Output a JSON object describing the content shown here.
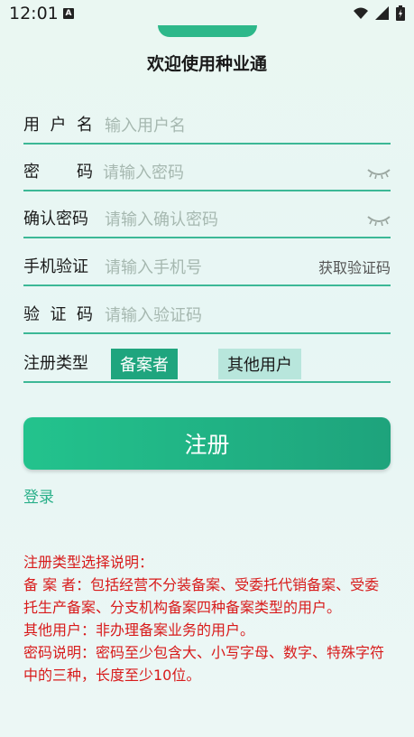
{
  "status_bar": {
    "time": "12:01",
    "notification_icon_letter": "A",
    "icons": [
      "wifi-icon",
      "signal-icon",
      "battery-icon"
    ]
  },
  "title": "欢迎使用种业通",
  "form": {
    "username": {
      "label": "用户名",
      "placeholder": "输入用户名"
    },
    "password": {
      "label": "密码",
      "placeholder": "请输入密码"
    },
    "confirm_password": {
      "label": "确认密码",
      "placeholder": "请输入确认密码"
    },
    "phone": {
      "label": "手机验证",
      "placeholder": "请输入手机号",
      "get_code": "获取验证码"
    },
    "code": {
      "label": "验证码",
      "placeholder": "请输入验证码"
    },
    "reg_type": {
      "label": "注册类型",
      "options": [
        "备案者",
        "其他用户"
      ],
      "selected": "备案者"
    }
  },
  "register_button": "注册",
  "login_link": "登录",
  "notes": [
    "注册类型选择说明：",
    "备 案 者：包括经营不分装备案、受委托代销备案、受委托生产备案、分支机构备案四种备案类型的用户。",
    "其他用户：非办理备案业务的用户。",
    "密码说明：密码至少包含大、小写字母、数字、特殊字符中的三种，长度至少10位。"
  ],
  "colors": {
    "accent": "#1fa57e",
    "accent_light": "#b8e6dc",
    "note_red": "#d81b1b",
    "link": "#2bb08a"
  }
}
